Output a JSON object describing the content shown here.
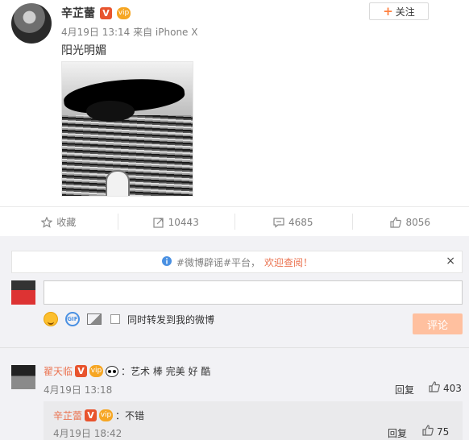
{
  "post": {
    "author_name": "辛芷蕾",
    "verified_badge": "V",
    "vip_badge": "vip",
    "follow_label": "关注",
    "meta": "4月19日 13:14 来自 iPhone X",
    "text": "阳光明媚"
  },
  "actions": [
    {
      "icon": "star-icon",
      "label": "收藏"
    },
    {
      "icon": "repost-icon",
      "label": "10443"
    },
    {
      "icon": "comment-icon",
      "label": "4685"
    },
    {
      "icon": "like-icon",
      "label": "8056"
    }
  ],
  "notice": {
    "text": "#微博辟谣#平台，",
    "link": "欢迎查阅！",
    "close": "×"
  },
  "composer": {
    "placeholder": "",
    "repost_label": "同时转发到我的微博",
    "submit_label": "评论",
    "gif_label": "GIF"
  },
  "comment": {
    "name": "翟天临",
    "verified_badge": "V",
    "vip_badge": "vip",
    "text": "：艺术 棒 完美 好 酷",
    "time": "4月19日 13:18",
    "reply_label": "回复",
    "likes": "403",
    "reply": {
      "name": "辛芷蕾",
      "verified_badge": "V",
      "vip_badge": "vip",
      "text": "：不错",
      "time": "4月19日 18:42",
      "reply_label": "回复",
      "likes": "75"
    }
  },
  "colors": {
    "accent": "#eb7350",
    "follow_plus": "#ff8140",
    "submit_bg": "#ffc09f",
    "verified": "#e8542e",
    "vip": "#f6a623",
    "comment_bg": "#f2f2f5"
  }
}
